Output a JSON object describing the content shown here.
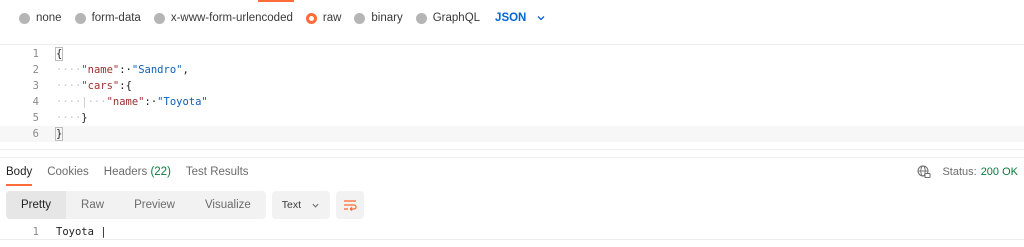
{
  "body_types": {
    "options": [
      {
        "label": "none",
        "selected": false
      },
      {
        "label": "form-data",
        "selected": false
      },
      {
        "label": "x-www-form-urlencoded",
        "selected": false
      },
      {
        "label": "raw",
        "selected": true
      },
      {
        "label": "binary",
        "selected": false
      },
      {
        "label": "GraphQL",
        "selected": false
      }
    ],
    "format": "JSON"
  },
  "editor": {
    "lines": [
      {
        "num": "1",
        "indent": "",
        "text": "{"
      },
      {
        "num": "2",
        "indent": "····",
        "key": "\"name\"",
        "sep": ":·",
        "value": "\"Sandro\"",
        "tail": ","
      },
      {
        "num": "3",
        "indent": "····",
        "key": "\"cars\"",
        "sep": ":",
        "tail": "{"
      },
      {
        "num": "4",
        "indent": "····|···",
        "key": "\"name\"",
        "sep": ":·",
        "value": "\"Toyota\""
      },
      {
        "num": "5",
        "indent": "····",
        "text": "}"
      },
      {
        "num": "6",
        "indent": "",
        "text": "}"
      }
    ]
  },
  "response": {
    "tabs": [
      {
        "label": "Body",
        "active": true
      },
      {
        "label": "Cookies",
        "active": false
      },
      {
        "label": "Headers",
        "count": "(22)",
        "active": false
      },
      {
        "label": "Test Results",
        "active": false
      }
    ],
    "status_label": "Status:",
    "status_value": "200 OK",
    "views": [
      "Pretty",
      "Raw",
      "Preview",
      "Visualize"
    ],
    "active_view": "Pretty",
    "format_select": "Text",
    "body_lines": [
      {
        "num": "1",
        "text": "Toyota |"
      }
    ]
  },
  "colors": {
    "accent": "#ff6c37",
    "link": "#0265d2",
    "success": "#0a7a3e"
  }
}
